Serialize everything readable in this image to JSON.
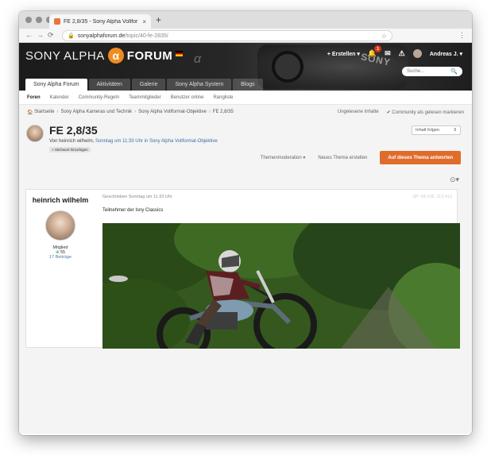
{
  "browser": {
    "tab_title": "FE 2,8/35 - Sony Alpha Vollfor",
    "tab_close": "×",
    "new_tab": "+",
    "back": "←",
    "forward": "→",
    "reload": "⟳",
    "url_host": "sonyalphaforum.de",
    "url_path": "/topic/40-fe-2835/",
    "bookmark": "☆",
    "menu": "⋮"
  },
  "site": {
    "logo_part1": "SONY ALPHA",
    "logo_alpha": "α",
    "logo_part2": "FORUM",
    "create_label": "+ Erstellen ▾",
    "notification_count": "1",
    "user_name": "Andreas J. ▾",
    "search_placeholder": "Suche...",
    "camera_brand": "SONY",
    "camera_mark": "α"
  },
  "nav": {
    "tabs": [
      "Sony Alpha Forum",
      "Aktivitäten",
      "Galerie",
      "Sony Alpha System",
      "Blogs"
    ],
    "subnav": [
      "Foren",
      "Kalender",
      "Community-Regeln",
      "Teammitglieder",
      "Benutzer online",
      "Rangliste"
    ]
  },
  "breadcrumb": {
    "items": [
      "Startseite",
      "Sony Alpha Kameras und Technik",
      "Sony Alpha Vollformat-Objektive",
      "FE 2,8/35"
    ],
    "unread": "Ungelesene Inhalte",
    "mark_read": "✔ Community als gelesen markieren"
  },
  "topic": {
    "title": "FE 2,8/35",
    "meta_prefix": "Von heinrich wilhelm, ",
    "meta_link": "Sonntag um 11:33 Uhr in Sony Alpha Vollformat-Objektive",
    "tag_button": "+ Stichwort hinzufügen",
    "follow": "Inhalt folgen",
    "moderation": "Themenmoderation ▾",
    "new_topic": "Neues Thema erstellen",
    "reply": "Auf dieses Thema antworten",
    "share_icon": "⊙▾"
  },
  "post": {
    "author": "heinrich wilhelm",
    "rank": "Mitglied",
    "reputation": "55",
    "post_count": "17 Beiträge",
    "date": "Geschrieben Sonntag um 11:33 Uhr",
    "exif": "SP: 04.109, 113.412",
    "text": "Teilnehmer der Isny Classics"
  },
  "colors": {
    "accent": "#e06c2b",
    "logo_badge": "#ef8b1f",
    "link": "#3a6fa8"
  }
}
